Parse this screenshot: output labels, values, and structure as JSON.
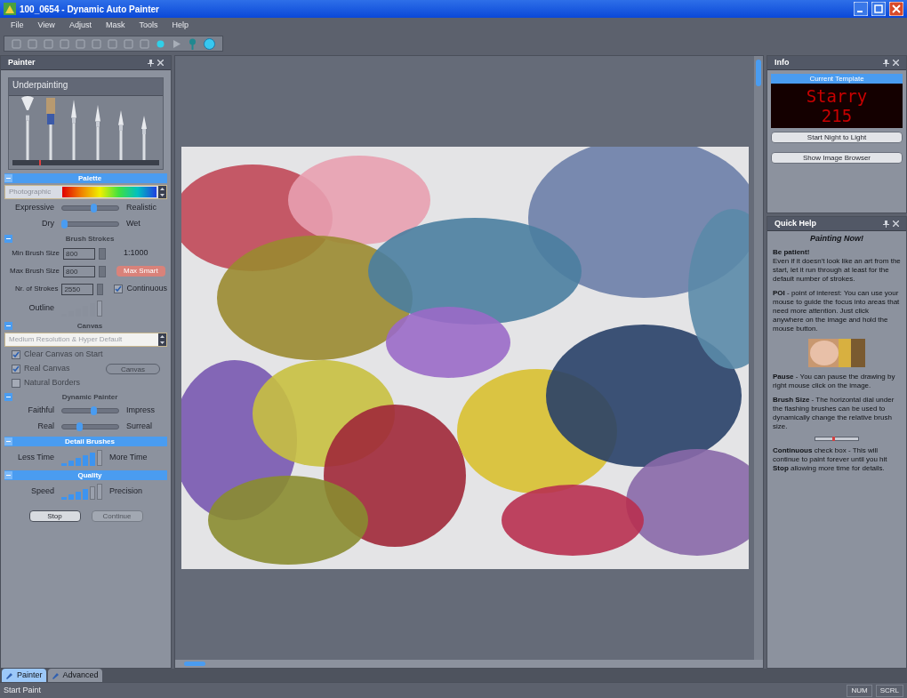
{
  "window": {
    "title": "100_0654 - Dynamic Auto Painter"
  },
  "menu": [
    "File",
    "View",
    "Adjust",
    "Mask",
    "Tools",
    "Help"
  ],
  "painter_panel": {
    "title": "Painter",
    "style": "Underpainting",
    "brushes": [
      {
        "selected": false
      },
      {
        "selected": true
      },
      {
        "selected": false
      },
      {
        "selected": false
      },
      {
        "selected": false
      },
      {
        "selected": false
      }
    ],
    "brush_size": {
      "level": 0.18
    },
    "sections": [
      {
        "title": "Palette",
        "active": true,
        "expanded": true,
        "items": [
          {
            "kind": "palette",
            "value": "Photographic"
          },
          {
            "kind": "slider",
            "left": "Expressive",
            "right": "Realistic",
            "level": 0.55
          },
          {
            "kind": "slider",
            "left": "Dry",
            "right": "Wet",
            "level": 0.03
          }
        ]
      },
      {
        "title": "Brush Strokes",
        "active": false,
        "expanded": true,
        "items": [
          {
            "kind": "field",
            "label": "Min Brush Size",
            "value": "800",
            "note": "1:1000"
          },
          {
            "kind": "field",
            "label": "Max Brush Size",
            "value": "800",
            "button": "Max Smart"
          },
          {
            "kind": "field",
            "label": "Nr. of Strokes",
            "value": "2550",
            "check": {
              "label": "Continuous",
              "checked": true
            }
          },
          {
            "kind": "meter",
            "left": "Outline",
            "level": 0.83
          }
        ]
      },
      {
        "title": "Canvas",
        "active": false,
        "expanded": true,
        "items": [
          {
            "kind": "dropdown",
            "value": "Medium Resolution & Hyper Default"
          },
          {
            "kind": "checkbox",
            "label": "Clear Canvas on Start",
            "checked": true
          },
          {
            "kind": "checkbox",
            "label": "Real Canvas",
            "checked": true,
            "button": "Canvas"
          },
          {
            "kind": "checkbox",
            "label": "Natural Borders",
            "checked": false
          }
        ]
      },
      {
        "title": "Dynamic Painter",
        "active": false,
        "expanded": true,
        "items": [
          {
            "kind": "slider",
            "left": "Faithful",
            "right": "Impress",
            "level": 0.55
          },
          {
            "kind": "slider",
            "left": "Real",
            "right": "Surreal",
            "level": 0.3
          }
        ]
      },
      {
        "title": "Detail Brushes",
        "active": true,
        "expanded": true,
        "items": [
          {
            "kind": "meter",
            "left": "Less Time",
            "right": "More Time",
            "level": 0.83
          }
        ]
      },
      {
        "title": "Quality",
        "active": true,
        "expanded": true,
        "items": [
          {
            "kind": "meter",
            "left": "Speed",
            "right": "Precision",
            "level": 0.67
          },
          {
            "kind": "buttons",
            "buttons": [
              {
                "label": "Stop",
                "disabled": false
              },
              {
                "label": "Continue",
                "disabled": true
              }
            ]
          }
        ]
      }
    ]
  },
  "info_panel": {
    "title": "Info",
    "template_label": "Current Template",
    "display": [
      "Starry",
      "215"
    ],
    "buttons": [
      "Start Night to Light",
      "Show Image Browser"
    ]
  },
  "help_panel": {
    "title": "Quick Help",
    "heading": "Painting Now!",
    "blocks": [
      {
        "kind": "heading",
        "text": "Be patient!"
      },
      {
        "kind": "text",
        "text": "Even if it doesn't look like an art from the start, let it run through at least for the default number of strokes."
      },
      {
        "kind": "text",
        "text": "**POI** - point of interest: You can use your mouse to guide the focus into areas that need more attention. Just click anywhere on the image and hold the mouse button."
      },
      {
        "kind": "picture"
      },
      {
        "kind": "text",
        "text": "**Pause** - You can pause the drawing by right mouse click on the image."
      },
      {
        "kind": "text",
        "text": "**Brush Size** - The horizontal dial under the flashing brushes can be used to dynamically change the relative brush size."
      },
      {
        "kind": "dial",
        "level": 0.4
      },
      {
        "kind": "text",
        "text": "**Continuous** check box - This will continue to paint forever until you hit **Stop** allowing more time for details."
      }
    ]
  },
  "bottom_tabs": [
    {
      "label": "Painter",
      "selected": true
    },
    {
      "label": "Advanced",
      "selected": false
    }
  ],
  "status_bar": {
    "text": "Start Paint",
    "indicators": [
      "NUM",
      "SCRL"
    ]
  }
}
